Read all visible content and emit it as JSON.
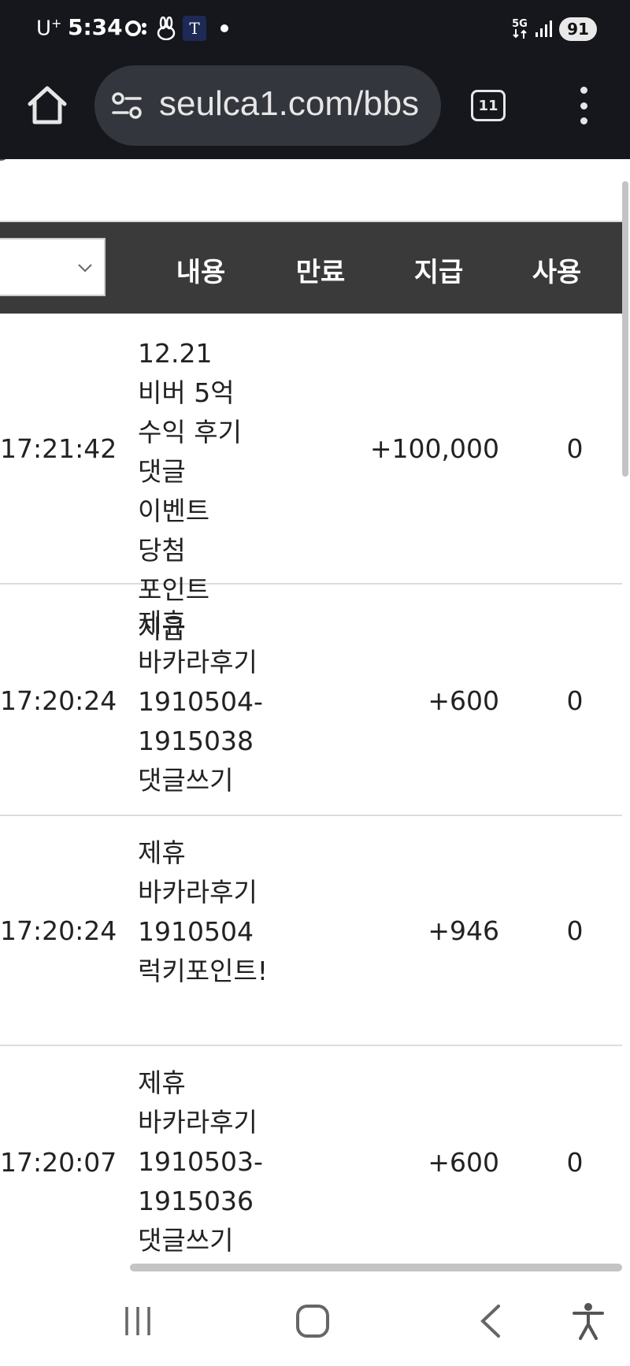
{
  "status_bar": {
    "carrier": "U",
    "carrier_sup": "+",
    "time": "5:34",
    "network": "5G",
    "battery": "91"
  },
  "browser": {
    "url": "seulca1.com/bbs",
    "tab_count": "11"
  },
  "table": {
    "headers": {
      "content": "내용",
      "expire": "만료",
      "pay": "지급",
      "use": "사용"
    },
    "rows": [
      {
        "time": "17:21:42",
        "desc": "12.21 비버 5억 수익 후기 댓글 이벤트 당첨 포인트 지급",
        "pay": "+100,000",
        "use": "0"
      },
      {
        "time": "17:20:24",
        "desc": "제휴 바카라후기 1910504-1915038 댓글쓰기",
        "pay": "+600",
        "use": "0"
      },
      {
        "time": "17:20:24",
        "desc": "제휴 바카라후기 1910504 럭키포인트!",
        "pay": "+946",
        "use": "0"
      },
      {
        "time": "17:20:07",
        "desc": "제휴 바카라후기 1910503-1915036 댓글쓰기",
        "pay": "+600",
        "use": "0"
      }
    ]
  }
}
